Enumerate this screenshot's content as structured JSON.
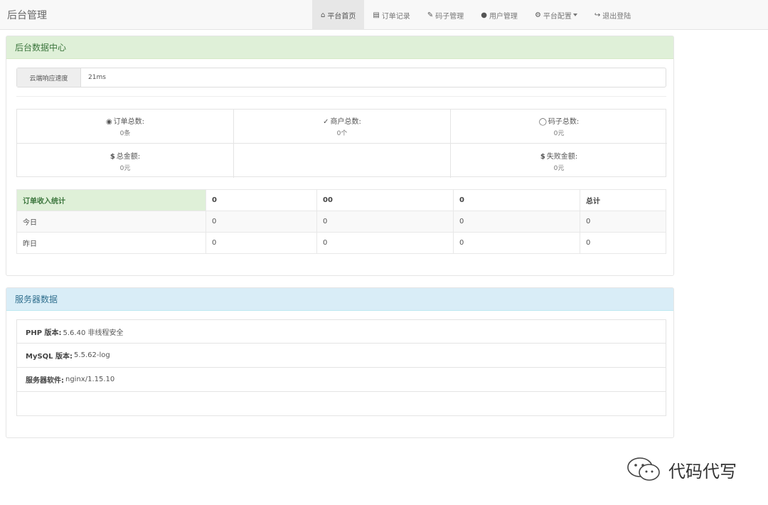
{
  "navbar": {
    "brand": "后台管理",
    "items": [
      {
        "label": "平台首页",
        "icon": "home-icon",
        "active": true
      },
      {
        "label": "订单记录",
        "icon": "list-icon",
        "active": false
      },
      {
        "label": "码子管理",
        "icon": "edit-icon",
        "active": false
      },
      {
        "label": "用户管理",
        "icon": "user-icon",
        "active": false
      },
      {
        "label": "平台配置",
        "icon": "gear-icon",
        "active": false
      },
      {
        "label": "退出登陆",
        "icon": "logout-icon",
        "active": false
      }
    ]
  },
  "data_center": {
    "title": "后台数据中心",
    "speed_label": "云端响应速度",
    "speed_value": "21ms",
    "stats": [
      {
        "label": "订单总数:",
        "value": "0条",
        "icon": "drop-icon"
      },
      {
        "label": "商户总数:",
        "value": "0个",
        "icon": "user-check-icon"
      },
      {
        "label": "码子总数:",
        "value": "0元",
        "icon": "circle-icon"
      },
      {
        "label": "总金额:",
        "value": "0元",
        "icon": "dollar-icon"
      },
      {
        "label": "",
        "value": "",
        "icon": ""
      },
      {
        "label": "失败金额:",
        "value": "0元",
        "icon": "dollar-icon"
      }
    ],
    "income_table": {
      "headers": [
        "订单收入统计",
        "0",
        "00",
        "0",
        "总计"
      ],
      "rows": [
        {
          "label": "今日",
          "values": [
            "0",
            "0",
            "0",
            "0"
          ]
        },
        {
          "label": "昨日",
          "values": [
            "0",
            "0",
            "0",
            "0"
          ]
        }
      ]
    }
  },
  "server": {
    "title": "服务器数据",
    "items": [
      {
        "key": "PHP 版本:",
        "value": "5.6.40 非线程安全"
      },
      {
        "key": "MySQL 版本:",
        "value": "5.5.62-log"
      },
      {
        "key": "服务器软件:",
        "value": "nginx/1.15.10"
      }
    ]
  },
  "watermark": {
    "text": "代码代写",
    "icon": "wechat-icon"
  }
}
